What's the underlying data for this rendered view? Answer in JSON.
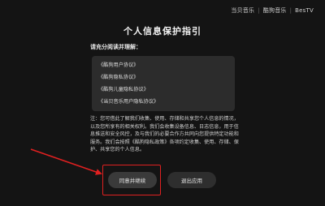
{
  "brand": {
    "logo1": "当贝音乐",
    "logo2": "酷狗音乐",
    "logo3": "BesTV"
  },
  "dialog": {
    "title": "个人信息保护指引",
    "subtitle": "请充分阅读并理解：",
    "agreements": [
      "《酷狗用户协议》",
      "《酷狗隐私协议》",
      "《酷狗儿童隐私协议》",
      "《当贝音乐用户隐私协议》"
    ],
    "notice": "注：您可借此了解我们收集、使用、存储和共享您个人信息的情况，以及您所享有的相关权利。我们会收集设备信息、日志信息，用于信息推送和安全风控，及与我们的必要合作方共同向您提供特定功能和服务。我们会按照《酷狗隐私政策》各项约定收集、使用、存储、保护、共享您的个人信息。",
    "agree_button": "同意并继续",
    "exit_button": "退出应用"
  },
  "annotation": {
    "highlight_color": "#e02020"
  }
}
